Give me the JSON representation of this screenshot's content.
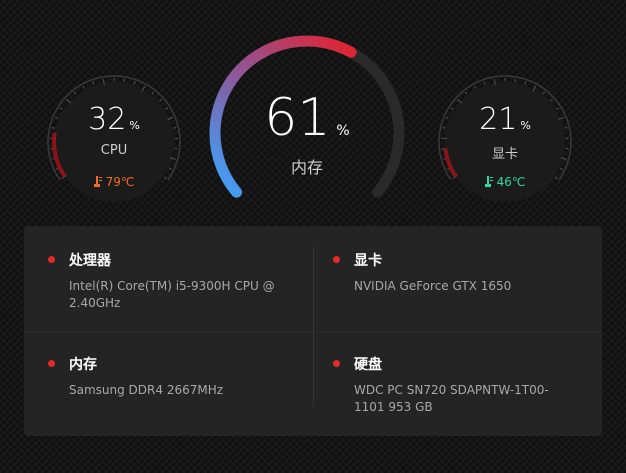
{
  "gauges": {
    "cpu": {
      "value": "32",
      "unit": "%",
      "label": "CPU",
      "temp": "79℃",
      "level": 0.32,
      "temp_color": "#f36b25"
    },
    "memory": {
      "value": "61",
      "unit": "%",
      "label": "内存",
      "level": 0.61
    },
    "gpu": {
      "value": "21",
      "unit": "%",
      "label": "显卡",
      "temp": "46℃",
      "level": 0.21,
      "temp_color": "#2fd8a0"
    }
  },
  "specs": {
    "cpu": {
      "title": "处理器",
      "value": "Intel(R) Core(TM) i5-9300H CPU @ 2.40GHz"
    },
    "gpu": {
      "title": "显卡",
      "value": "NVIDIA GeForce GTX 1650"
    },
    "memory": {
      "title": "内存",
      "value": "Samsung DDR4 2667MHz"
    },
    "disk": {
      "title": "硬盘",
      "value": "WDC PC SN720 SDAPNTW-1T00-1101 953 GB"
    }
  },
  "colors": {
    "accent": "#e52a2a",
    "arc_start": "#3aa6ff",
    "arc_end": "#e2222f",
    "track": "#2a2a2a",
    "panel": "#242424"
  }
}
